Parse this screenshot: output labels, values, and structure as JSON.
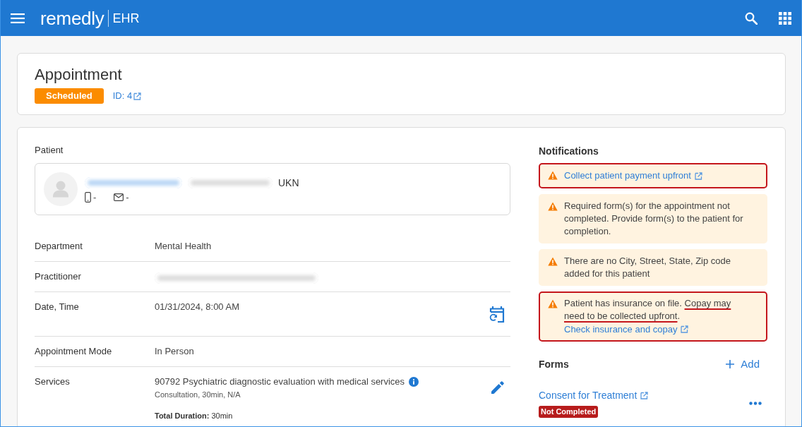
{
  "header": {
    "logo": "remedly",
    "product": "EHR"
  },
  "appointment": {
    "title": "Appointment",
    "status": {
      "label": "Scheduled",
      "kind": "scheduled"
    },
    "id_link": "ID: 4"
  },
  "patient": {
    "label": "Patient",
    "name_blurred": true,
    "birth_blurred": true,
    "gender": "UKN",
    "phone": "-",
    "email": "-"
  },
  "details": [
    {
      "kind": "text",
      "label": "Department",
      "value": "Mental Health"
    },
    {
      "kind": "blurred",
      "label": "Practitioner"
    },
    {
      "kind": "datetime",
      "label": "Date, Time",
      "value": "01/31/2024, 8:00 AM"
    },
    {
      "kind": "text",
      "label": "Appointment Mode",
      "value": "In Person"
    },
    {
      "kind": "services",
      "label": "Services",
      "value": "90792 Psychiatric diagnostic evaluation with medical services",
      "detail": "Consultation, 30min, N/A",
      "total": "**Total Duration:** 30min"
    }
  ],
  "notifications": {
    "title": "Notifications",
    "items": [
      {
        "kind": "link",
        "highlighted": true,
        "link": "Collect patient payment upfront"
      },
      {
        "kind": "text",
        "highlighted": false,
        "text": "Required form(s) for the appointment not completed. Provide form(s) to the patient for completion."
      },
      {
        "kind": "text",
        "highlighted": false,
        "text": "There are no City, Street, State, Zip code added for this patient"
      },
      {
        "kind": "text_link",
        "highlighted": true,
        "text": "Patient has insurance on file. ",
        "underlined": "Copay may need to be collected upfront",
        "text_end": ".",
        "link": "Check insurance and copay"
      }
    ]
  },
  "forms": {
    "title": "Forms",
    "add_label": "Add",
    "items": [
      {
        "name": "Consent for Treatment",
        "status": {
          "label": "Not Completed",
          "kind": "not_completed"
        }
      }
    ]
  }
}
